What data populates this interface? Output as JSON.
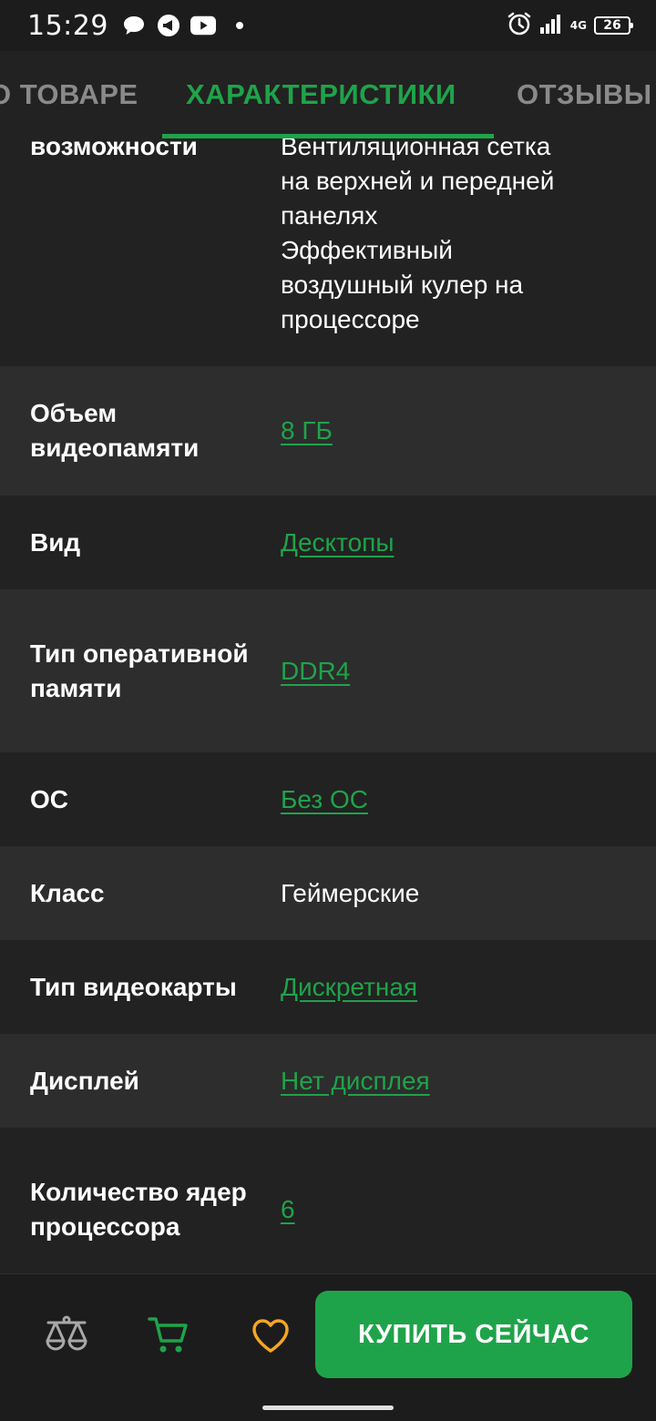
{
  "status": {
    "time": "15:29",
    "network": "4G",
    "battery": "26"
  },
  "tabs": {
    "about": "О ТОВАРЕ",
    "specs": "ХАРАКТЕРИСТИКИ",
    "reviews": "ОТЗЫВЫ"
  },
  "specs": {
    "features": {
      "label": "возможности",
      "value": "Вентиляционная сетка\nна верхней и передней\nпанелях\nЭффективный\nвоздушный кулер на\nпроцессоре"
    },
    "rows": [
      {
        "label": "Объем видеопамяти",
        "value": "8 ГБ"
      },
      {
        "label": "Вид",
        "value": "Десктопы"
      },
      {
        "label": "Тип оперативной памяти",
        "value": "DDR4"
      },
      {
        "label": "ОС",
        "value": "Без ОС"
      },
      {
        "label": "Класс",
        "value": "Геймерские"
      },
      {
        "label": "Тип видеокарты",
        "value": "Дискретная"
      },
      {
        "label": "Дисплей",
        "value": "Нет дисплея"
      },
      {
        "label": "Количество ядер процессора",
        "value": "6"
      }
    ]
  },
  "bottom_bar": {
    "buy_label": "КУПИТЬ СЕЙЧАС",
    "icons": [
      "compare-icon",
      "cart-icon",
      "heart-icon"
    ]
  },
  "colors": {
    "accent": "#1fa34a",
    "heart": "#f5a623",
    "background": "#222222",
    "row_alt": "#2d2d2d"
  }
}
